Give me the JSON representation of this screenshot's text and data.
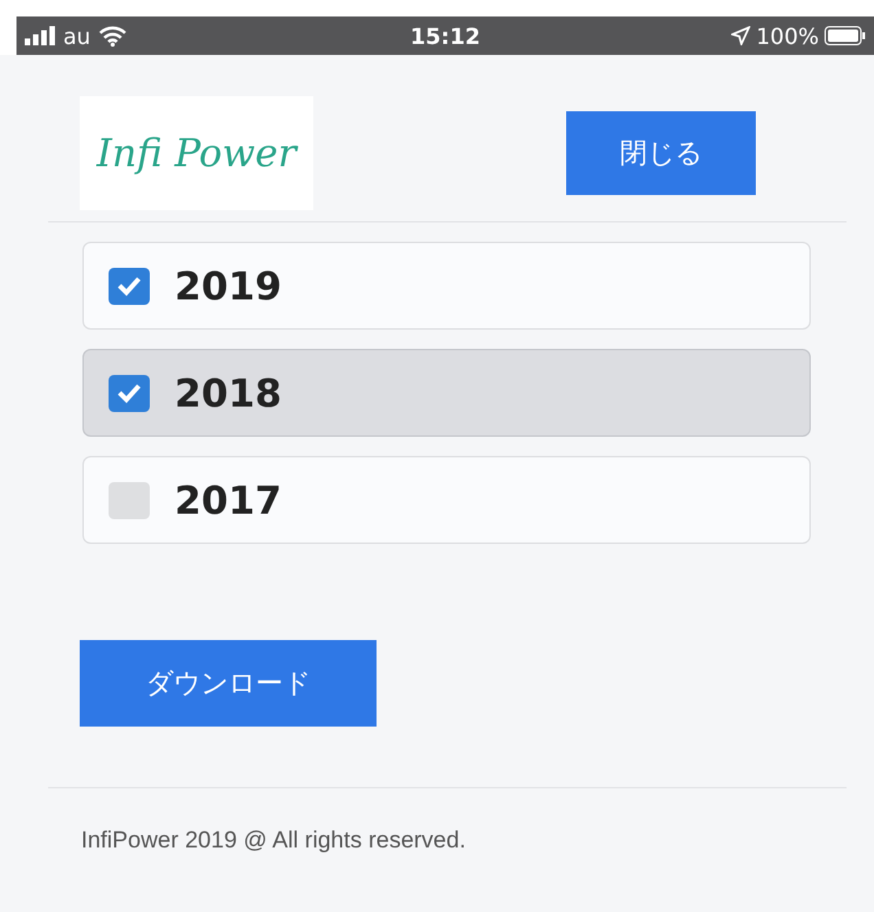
{
  "status_bar": {
    "carrier": "au",
    "time": "15:12",
    "battery": "100%"
  },
  "header": {
    "logo": "Infi Power",
    "close_button": "閉じる"
  },
  "years": [
    {
      "label": "2019",
      "checked": true,
      "highlighted": false
    },
    {
      "label": "2018",
      "checked": true,
      "highlighted": true
    },
    {
      "label": "2017",
      "checked": false,
      "highlighted": false
    }
  ],
  "download_button": "ダウンロード",
  "footer": "InfiPower 2019 @ All rights reserved."
}
